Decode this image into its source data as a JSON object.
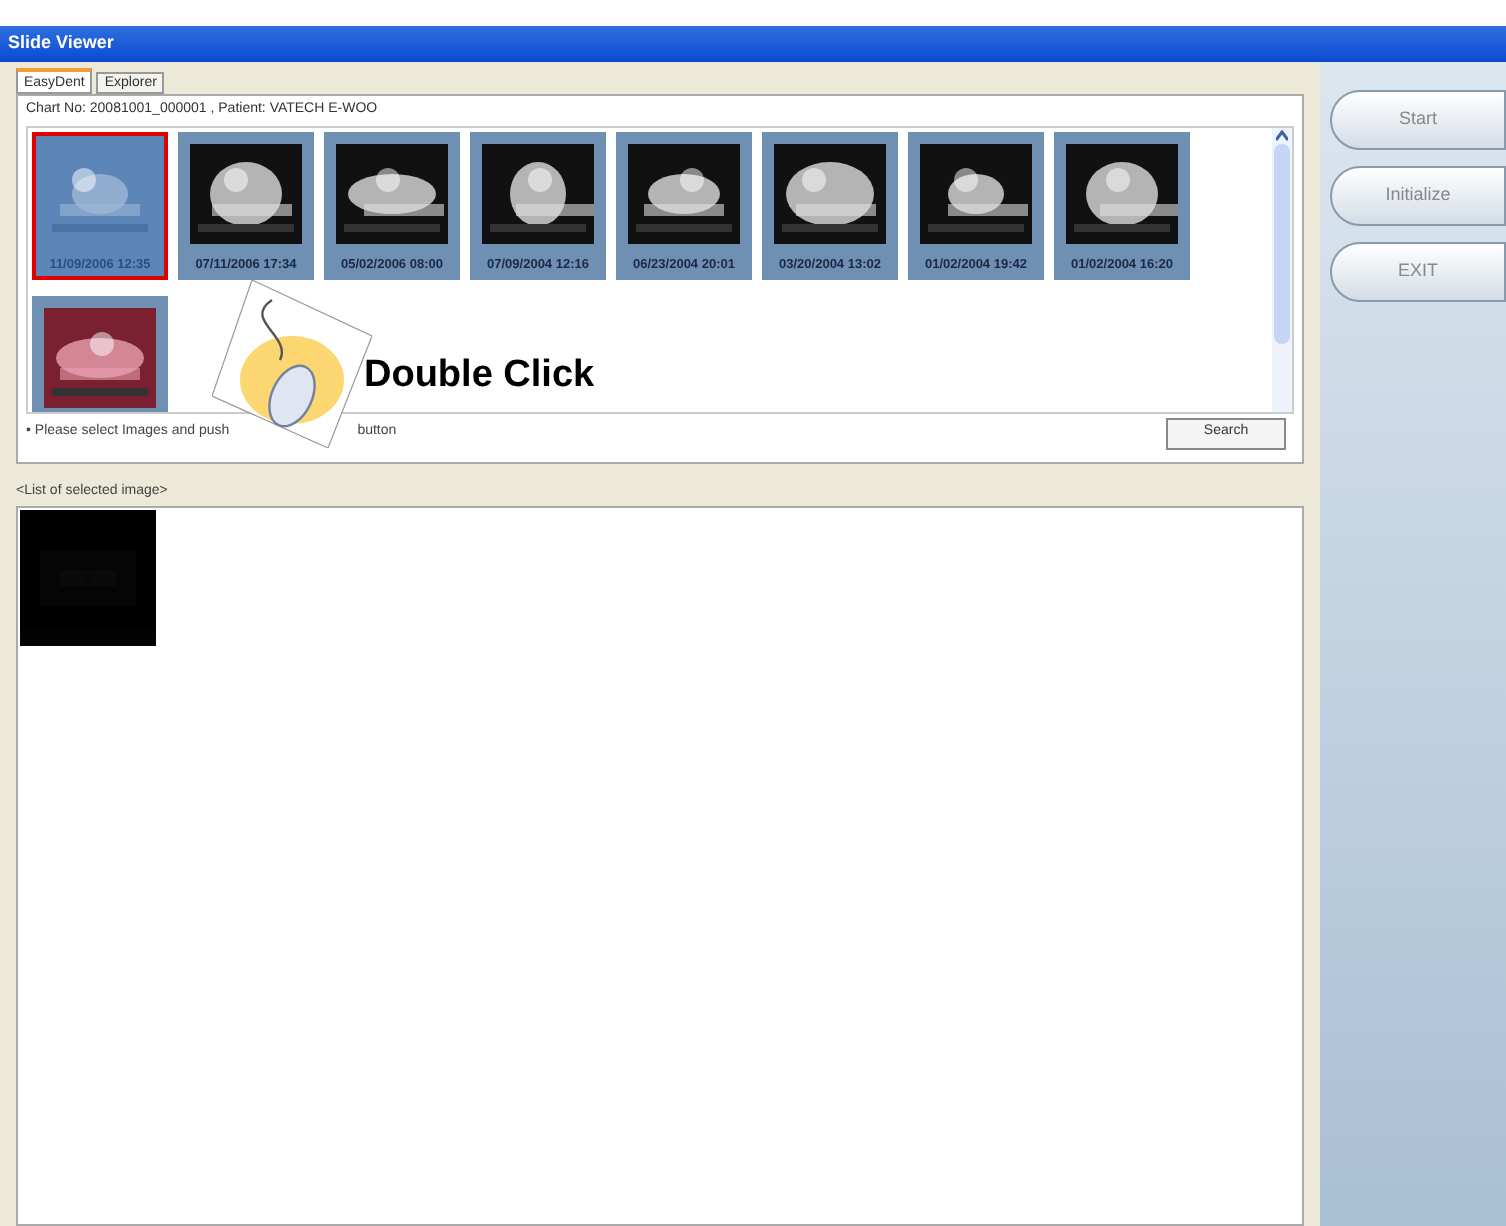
{
  "window": {
    "title": "Slide Viewer"
  },
  "tabs": [
    {
      "label": "EasyDent",
      "selected": true
    },
    {
      "label": "Explorer",
      "selected": false
    }
  ],
  "chart_info": "Chart No: 20081001_000001 , Patient: VATECH E-WOO",
  "thumbnails": [
    {
      "caption": "11/09/2006 12:35",
      "selected": true,
      "kind": "picture"
    },
    {
      "caption": "07/11/2006 17:34",
      "selected": false,
      "kind": "picture"
    },
    {
      "caption": "05/02/2006 08:00",
      "selected": false,
      "kind": "picture"
    },
    {
      "caption": "07/09/2004 12:16",
      "selected": false,
      "kind": "picture"
    },
    {
      "caption": "06/23/2004 20:01",
      "selected": false,
      "kind": "picture"
    },
    {
      "caption": "03/20/2004 13:02",
      "selected": false,
      "kind": "picture"
    },
    {
      "caption": "01/02/2004 19:42",
      "selected": false,
      "kind": "picture"
    },
    {
      "caption": "01/02/2004 16:20",
      "selected": false,
      "kind": "picture"
    },
    {
      "selected": false,
      "kind": "picture"
    }
  ],
  "hint": [
    "• Please select Images and push",
    "button"
  ],
  "search_button": "Search",
  "overlay": {
    "label": "Double Click"
  },
  "selected_list": {
    "title": "<List of selected image>",
    "items": [
      {
        "kind": "picture"
      }
    ]
  },
  "side_buttons": [
    "Start",
    "Initialize",
    "EXIT"
  ]
}
